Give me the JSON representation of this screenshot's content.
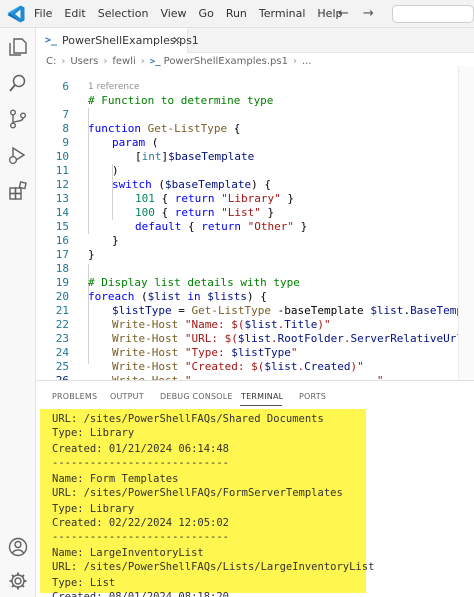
{
  "menu": [
    "File",
    "Edit",
    "Selection",
    "View",
    "Go",
    "Run",
    "Terminal",
    "Help"
  ],
  "tab": {
    "label": "PowerShellExamples.ps1",
    "icon": "powershell-icon"
  },
  "breadcrumb": [
    "C:",
    "Users",
    "fewli",
    "PowerShellExamples.ps1",
    "..."
  ],
  "codelens": "1 reference",
  "code_lines": [
    {
      "n": "6",
      "text": "# Function to determine type"
    },
    {
      "n": "7",
      "text": "function Get-ListType {"
    },
    {
      "n": "8",
      "text": "param ("
    },
    {
      "n": "9",
      "text": "[int]$baseTemplate"
    },
    {
      "n": "10",
      "text": ")"
    },
    {
      "n": "11",
      "text": "switch ($baseTemplate) {"
    },
    {
      "n": "12",
      "text": "101 { return \"Library\" }"
    },
    {
      "n": "13",
      "text": "100 { return \"List\" }"
    },
    {
      "n": "14",
      "text": "default { return \"Other\" }"
    },
    {
      "n": "15",
      "text": "}"
    },
    {
      "n": "16",
      "text": "}"
    },
    {
      "n": "17",
      "text": ""
    },
    {
      "n": "18",
      "text": "# Display list details with type"
    },
    {
      "n": "19",
      "text": "foreach ($list in $lists) {"
    },
    {
      "n": "20",
      "text": "$listType = Get-ListType -baseTemplate $list.BaseTemplate"
    },
    {
      "n": "21",
      "text": "Write-Host \"Name: $($list.Title)\""
    },
    {
      "n": "22",
      "text": "Write-Host \"URL: $($list.RootFolder.ServerRelativeUrl)\""
    },
    {
      "n": "23",
      "text": "Write-Host \"Type: $listType\""
    },
    {
      "n": "24",
      "text": "Write-Host \"Created: $($list.Created)\""
    },
    {
      "n": "25",
      "text": "Write-Host \"----------------------------\""
    },
    {
      "n": "26",
      "text": "}"
    }
  ],
  "panel_tabs": [
    "PROBLEMS",
    "OUTPUT",
    "DEBUG CONSOLE",
    "TERMINAL",
    "PORTS"
  ],
  "active_panel_tab": "TERMINAL",
  "terminal_lines": [
    "URL: /sites/PowerShellFAQs/Shared Documents",
    "Type: Library",
    "Created: 01/21/2024 06:14:48",
    "----------------------------",
    "Name: Form Templates",
    "URL: /sites/PowerShellFAQs/FormServerTemplates",
    "Type: Library",
    "Created: 02/22/2024 12:05:02",
    "----------------------------",
    "Name: LargeInventoryList",
    "URL: /sites/PowerShellFAQs/Lists/LargeInventoryList",
    "Type: List",
    "Created: 08/01/2024 08:18:20"
  ],
  "colors": {
    "highlight": "#fff64f",
    "keyword": "#0000ff",
    "comment": "#008000",
    "string": "#a31515",
    "accent": "#007acc"
  }
}
